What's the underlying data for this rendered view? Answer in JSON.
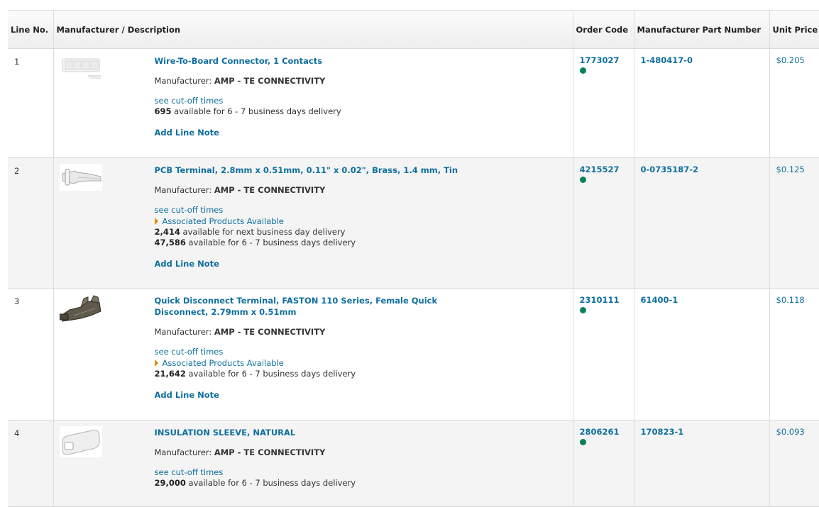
{
  "columns": {
    "line_no": "Line No.",
    "description": "Manufacturer / Description",
    "order_code": "Order Code",
    "mpn": "Manufacturer Part Number",
    "unit_price": "Unit Price"
  },
  "labels": {
    "manufacturer_prefix": "Manufacturer:",
    "cutoff": "see cut-off times",
    "associated": "Associated Products Available",
    "add_note": "Add Line Note"
  },
  "rows": [
    {
      "line": "1",
      "title": "Wire-To-Board Connector, 1 Contacts",
      "manufacturer": "AMP - TE CONNECTIVITY",
      "order_code": "1773027",
      "mpn": "1-480417-0",
      "price": "$0.205",
      "availability": [
        {
          "qty": "695",
          "text": "available for 6 - 7 business days delivery"
        }
      ],
      "image": "connector-housing-image"
    },
    {
      "line": "2",
      "title": "PCB Terminal, 2.8mm x 0.51mm, 0.11\" x 0.02\", Brass, 1.4 mm, Tin",
      "manufacturer": "AMP - TE CONNECTIVITY",
      "order_code": "4215527",
      "mpn": "0-0735187-2",
      "price": "$0.125",
      "availability": [
        {
          "qty": "2,414",
          "text": "available for next business day delivery"
        },
        {
          "qty": "47,586",
          "text": "available for 6 - 7 business days delivery"
        }
      ],
      "image": "pcb-terminal-image"
    },
    {
      "line": "3",
      "title": "Quick Disconnect Terminal, FASTON 110 Series, Female Quick Disconnect, 2.79mm x 0.51mm",
      "manufacturer": "AMP - TE CONNECTIVITY",
      "order_code": "2310111",
      "mpn": "61400-1",
      "price": "$0.118",
      "availability": [
        {
          "qty": "21,642",
          "text": "available for 6 - 7 business days delivery"
        }
      ],
      "image": "faston-terminal-image"
    },
    {
      "line": "4",
      "title": "INSULATION SLEEVE, NATURAL",
      "manufacturer": "AMP - TE CONNECTIVITY",
      "order_code": "2806261",
      "mpn": "170823-1",
      "price": "$0.093",
      "availability": [
        {
          "qty": "29,000",
          "text": "available for 6 - 7 business days delivery"
        }
      ],
      "image": "insulation-sleeve-image"
    }
  ],
  "colors": {
    "link": "#0f6f9f",
    "stock_dot": "#0b7f5c",
    "associated_arrow": "#e08a00"
  }
}
